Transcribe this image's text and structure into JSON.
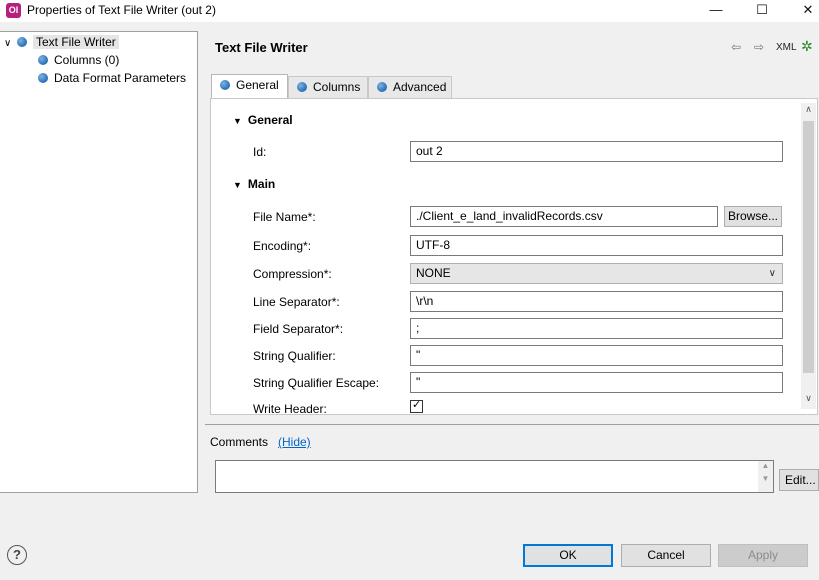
{
  "window": {
    "icon_text": "Ol",
    "title": "Properties of Text File Writer (out 2)",
    "minimize": "—",
    "maximize": "☐",
    "close": "✕"
  },
  "tree": {
    "root": {
      "label": "Text File Writer",
      "expanded": true,
      "selected": true
    },
    "children": [
      {
        "label": "Columns (0)"
      },
      {
        "label": "Data Format Parameters"
      }
    ]
  },
  "editor": {
    "title": "Text File Writer",
    "header_icons": {
      "back": "⇦",
      "forward": "⇨",
      "xml": "XML",
      "bug": "✲"
    }
  },
  "tabs": [
    {
      "label": "General",
      "active": true
    },
    {
      "label": "Columns",
      "active": false
    },
    {
      "label": "Advanced",
      "active": false
    }
  ],
  "general": {
    "section_general": "General",
    "id_label": "Id:",
    "id_value": "out 2",
    "section_main": "Main",
    "file_name_label": "File Name*:",
    "file_name_value": "./Client_e_land_invalidRecords.csv",
    "browse_label": "Browse...",
    "encoding_label": "Encoding*:",
    "encoding_value": "UTF-8",
    "compression_label": "Compression*:",
    "compression_value": "NONE",
    "line_sep_label": "Line Separator*:",
    "line_sep_value": "\\r\\n",
    "field_sep_label": "Field Separator*:",
    "field_sep_value": ";",
    "string_qualifier_label": "String Qualifier:",
    "string_qualifier_value": "\"",
    "string_qualifier_escape_label": "String Qualifier Escape:",
    "string_qualifier_escape_value": "\"",
    "write_header_label": "Write Header:",
    "write_header_checked": true
  },
  "comments": {
    "label": "Comments",
    "hide_link": "(Hide)",
    "value": "",
    "edit_label": "Edit..."
  },
  "footer": {
    "help": "?",
    "ok_label": "OK",
    "cancel_label": "Cancel",
    "apply_label": "Apply"
  }
}
